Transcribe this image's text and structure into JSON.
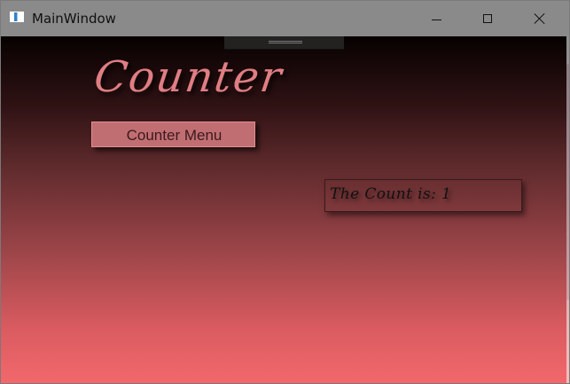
{
  "window": {
    "title": "MainWindow",
    "icons": {
      "app": "window-app-icon",
      "minimize": "minimize-icon",
      "maximize": "maximize-icon",
      "close": "close-icon"
    }
  },
  "main": {
    "title": "Counter",
    "menu_button_label": "Counter Menu",
    "count_text": "The Count is: 1",
    "drag_handle_icon": "drag-handle-icon"
  },
  "colors": {
    "gradient_top": "#070101",
    "gradient_bottom": "#f2686c",
    "title_text": "#df7e83",
    "button_background": "#c16e73"
  }
}
